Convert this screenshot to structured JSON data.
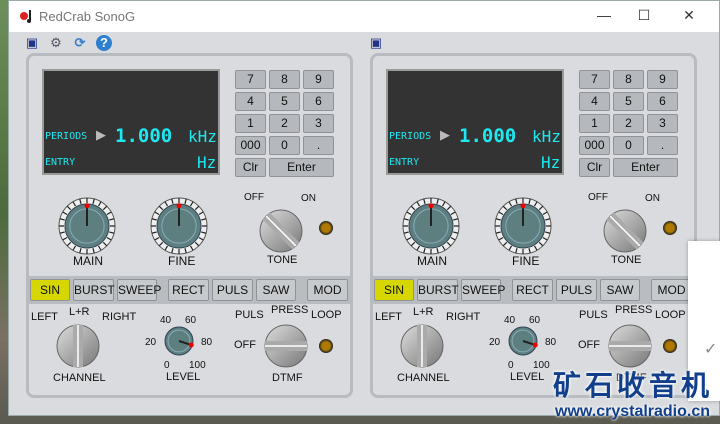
{
  "window": {
    "title": "RedCrab SonoG",
    "minimize": "—",
    "maximize": "☐",
    "close": "✕"
  },
  "toolbar": {
    "save": "💾",
    "settings": "⚙",
    "refresh": "⟳",
    "help": "?"
  },
  "panels": [
    {
      "display": {
        "mode": "PERIODS",
        "value": "1.000",
        "unit_top": "kHz",
        "entry": "ENTRY",
        "unit_bottom": "Hz"
      },
      "keypad": [
        "7",
        "8",
        "9",
        "4",
        "5",
        "6",
        "1",
        "2",
        "3",
        "000",
        "0",
        ".",
        "Clr",
        "Enter"
      ],
      "knobs": {
        "main": "MAIN",
        "fine": "FINE",
        "tone": "TONE",
        "tone_off": "OFF",
        "tone_on": "ON"
      },
      "waves": [
        "SIN",
        "BURST",
        "SWEEP",
        "RECT",
        "PULS",
        "SAW",
        "MOD"
      ],
      "active_wave": "SIN",
      "channel": {
        "label": "CHANNEL",
        "left": "LEFT",
        "center": "L+R",
        "right": "RIGHT"
      },
      "level": {
        "label": "LEVEL",
        "ticks": [
          "0",
          "20",
          "40",
          "60",
          "80",
          "100"
        ],
        "value": 90
      },
      "dtmf": {
        "label": "DTMF",
        "off": "OFF",
        "puls": "PULS",
        "press": "PRESS",
        "loop": "LOOP"
      }
    },
    {
      "display": {
        "mode": "PERIODS",
        "value": "1.000",
        "unit_top": "kHz",
        "entry": "ENTRY",
        "unit_bottom": "Hz"
      },
      "keypad": [
        "7",
        "8",
        "9",
        "4",
        "5",
        "6",
        "1",
        "2",
        "3",
        "000",
        "0",
        ".",
        "Clr",
        "Enter"
      ],
      "knobs": {
        "main": "MAIN",
        "fine": "FINE",
        "tone": "TONE",
        "tone_off": "OFF",
        "tone_on": "ON"
      },
      "waves": [
        "SIN",
        "BURST",
        "SWEEP",
        "RECT",
        "PULS",
        "SAW",
        "MOD"
      ],
      "active_wave": "SIN",
      "channel": {
        "label": "CHANNEL",
        "left": "LEFT",
        "center": "L+R",
        "right": "RIGHT"
      },
      "level": {
        "label": "LEVEL",
        "ticks": [
          "0",
          "20",
          "40",
          "60",
          "80",
          "100"
        ],
        "value": 90
      },
      "dtmf": {
        "label": "DTMF",
        "off": "OFF",
        "puls": "PULS",
        "press": "PRESS",
        "loop": "LOOP"
      }
    }
  ],
  "watermark": {
    "title": "矿石收音机",
    "url": "www.crystalradio.cn"
  },
  "popup": {
    "check": "✓"
  }
}
